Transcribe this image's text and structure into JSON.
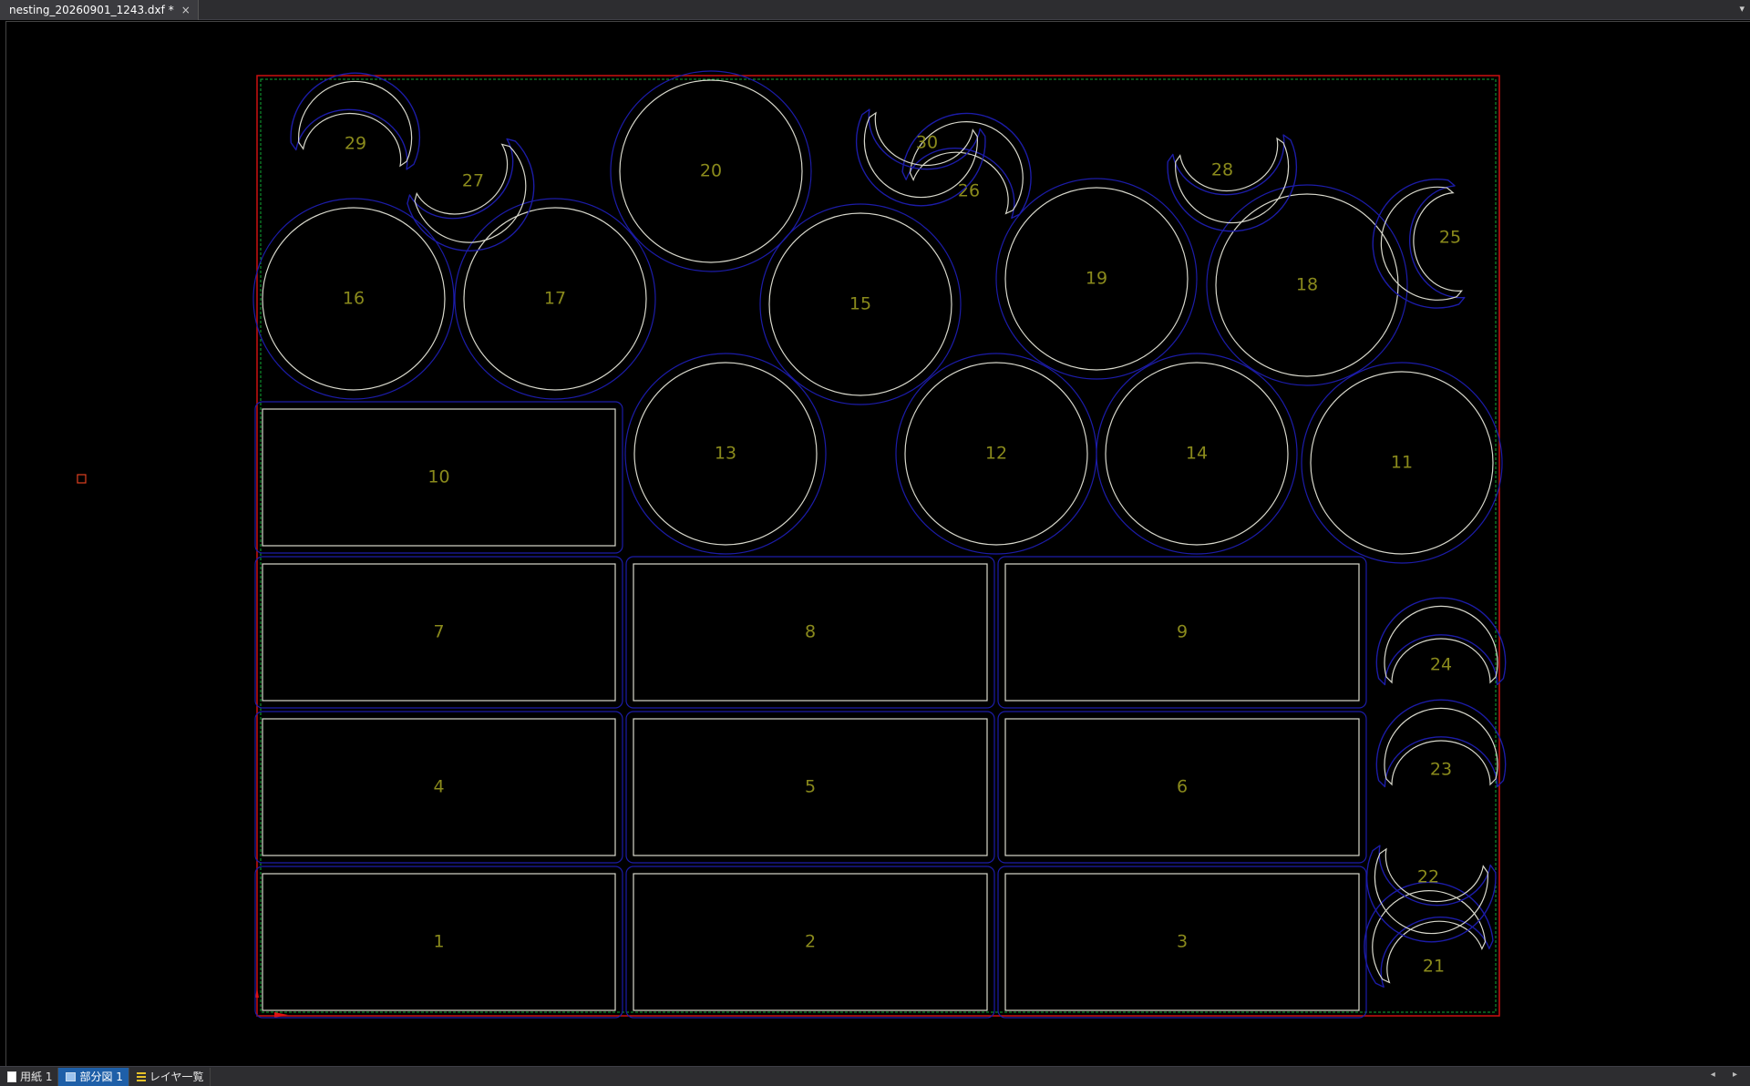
{
  "window": {
    "tab_title": "nesting_20260901_1243.dxf *",
    "close_glyph": "×",
    "menu_glyph": "▾"
  },
  "status_tabs": [
    {
      "label": "用紙 1",
      "icon": "paper-icon",
      "active": false
    },
    {
      "label": "部分図 1",
      "icon": "part-view-icon",
      "active": true
    },
    {
      "label": "レイヤ一覧",
      "icon": "layer-list-icon",
      "active": false
    }
  ],
  "scroll_arrows": "◂ ▸",
  "colors": {
    "sheet_border": "#cc1111",
    "margin_line": "#11aa33",
    "part_outline": "#d8d8cc",
    "part_offset": "#1c1ca8",
    "part_label": "#8a8a1c",
    "origin_marker": "#e04020"
  },
  "parts": {
    "rectangles": [
      {
        "label": "1"
      },
      {
        "label": "2"
      },
      {
        "label": "3"
      },
      {
        "label": "4"
      },
      {
        "label": "5"
      },
      {
        "label": "6"
      },
      {
        "label": "7"
      },
      {
        "label": "8"
      },
      {
        "label": "9"
      },
      {
        "label": "10"
      }
    ],
    "circles": [
      {
        "label": "11"
      },
      {
        "label": "12"
      },
      {
        "label": "13"
      },
      {
        "label": "14"
      },
      {
        "label": "15"
      },
      {
        "label": "16"
      },
      {
        "label": "17"
      },
      {
        "label": "18"
      },
      {
        "label": "19"
      },
      {
        "label": "20"
      }
    ],
    "crescents": [
      {
        "label": "21"
      },
      {
        "label": "22"
      },
      {
        "label": "23"
      },
      {
        "label": "24"
      },
      {
        "label": "25"
      },
      {
        "label": "26"
      },
      {
        "label": "27"
      },
      {
        "label": "28"
      },
      {
        "label": "29"
      },
      {
        "label": "30"
      }
    ]
  }
}
